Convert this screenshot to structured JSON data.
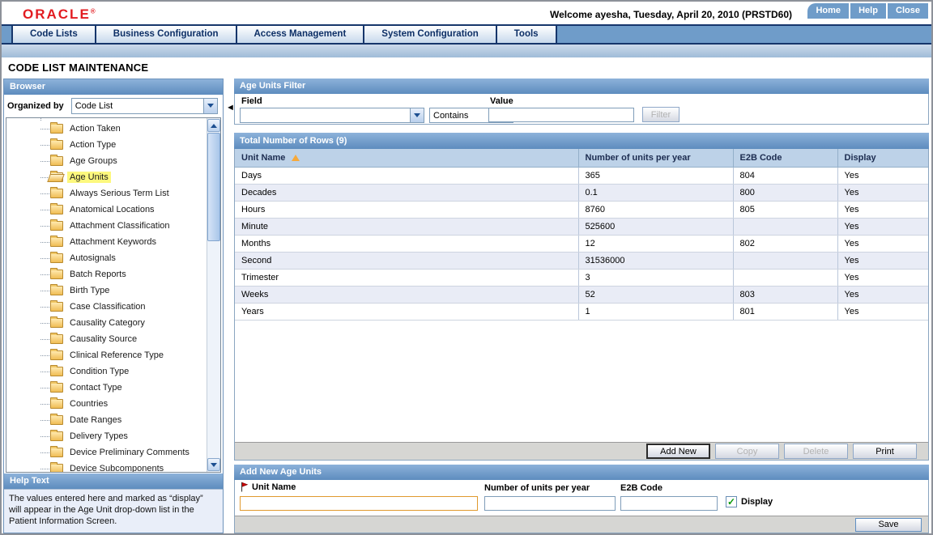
{
  "header": {
    "logo": "ORACLE",
    "welcome": "Welcome ayesha, Tuesday, April 20, 2010 (PRSTD60)",
    "buttons": [
      {
        "label": "Home"
      },
      {
        "label": "Help"
      },
      {
        "label": "Close"
      }
    ]
  },
  "nav": {
    "tabs": [
      {
        "label": "Code Lists"
      },
      {
        "label": "Business Configuration"
      },
      {
        "label": "Access Management"
      },
      {
        "label": "System Configuration"
      },
      {
        "label": "Tools"
      }
    ]
  },
  "page_title": "CODE LIST MAINTENANCE",
  "sidebar": {
    "title": "Browser",
    "organized_by_label": "Organized by",
    "organized_by_value": "Code List",
    "tree": [
      {
        "label": "Action Taken"
      },
      {
        "label": "Action Type"
      },
      {
        "label": "Age Groups"
      },
      {
        "label": "Age Units",
        "selected": true
      },
      {
        "label": "Always Serious Term List"
      },
      {
        "label": "Anatomical Locations"
      },
      {
        "label": "Attachment Classification"
      },
      {
        "label": "Attachment Keywords"
      },
      {
        "label": "Autosignals"
      },
      {
        "label": "Batch Reports"
      },
      {
        "label": "Birth Type"
      },
      {
        "label": "Case Classification"
      },
      {
        "label": "Causality Category"
      },
      {
        "label": "Causality Source"
      },
      {
        "label": "Clinical Reference Type"
      },
      {
        "label": "Condition Type"
      },
      {
        "label": "Contact Type"
      },
      {
        "label": "Countries"
      },
      {
        "label": "Date Ranges"
      },
      {
        "label": "Delivery Types"
      },
      {
        "label": "Device Preliminary Comments"
      },
      {
        "label": "Device Subcomponents"
      }
    ],
    "help": {
      "title": "Help Text",
      "text": "The values entered here and marked as “display” will appear in the Age Unit drop-down list in the  Patient Information Screen."
    }
  },
  "filter": {
    "title": "Age Units Filter",
    "field_label": "Field",
    "field_value": "",
    "operator_value": "Contains",
    "value_label": "Value",
    "value_text": "",
    "filter_button": {
      "label": "Filter",
      "enabled": false
    }
  },
  "table": {
    "title": "Total Number of Rows (9)",
    "columns": [
      "Unit Name",
      "Number of units per year",
      "E2B Code",
      "Display"
    ],
    "sorted_column": "Unit Name",
    "sort_direction": "asc",
    "rows": [
      [
        "Days",
        "365",
        "804",
        "Yes"
      ],
      [
        "Decades",
        "0.1",
        "800",
        "Yes"
      ],
      [
        "Hours",
        "8760",
        "805",
        "Yes"
      ],
      [
        "Minute",
        "525600",
        "",
        "Yes"
      ],
      [
        "Months",
        "12",
        "802",
        "Yes"
      ],
      [
        "Second",
        "31536000",
        "",
        "Yes"
      ],
      [
        "Trimester",
        "3",
        "",
        "Yes"
      ],
      [
        "Weeks",
        "52",
        "803",
        "Yes"
      ],
      [
        "Years",
        "1",
        "801",
        "Yes"
      ]
    ],
    "buttons": [
      {
        "label": "Add New",
        "enabled": true,
        "default": true
      },
      {
        "label": "Copy",
        "enabled": false
      },
      {
        "label": "Delete",
        "enabled": false
      },
      {
        "label": "Print",
        "enabled": true
      }
    ]
  },
  "add_new": {
    "title": "Add New Age Units",
    "fields": {
      "unit_name": {
        "label": "Unit Name",
        "value": "",
        "required": true
      },
      "units_per_year": {
        "label": "Number of units per year",
        "value": ""
      },
      "e2b_code": {
        "label": "E2B Code",
        "value": ""
      },
      "display": {
        "label": "Display",
        "checked": true
      }
    },
    "save_button": {
      "label": "Save",
      "enabled": false
    }
  },
  "colors": {
    "steel_blue": "#6f9cc9",
    "navy": "#16366b",
    "oracle_red": "#e21c21",
    "highlight_yellow": "#fdf87e",
    "alt_row": "#e9ecf6",
    "table_header_row": "#bdd2e8"
  }
}
